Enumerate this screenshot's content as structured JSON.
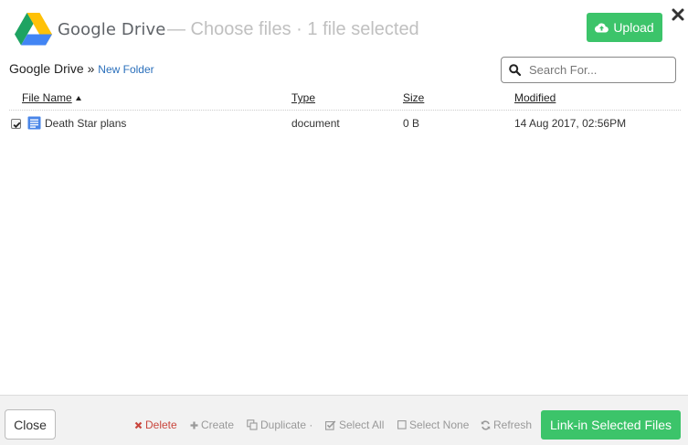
{
  "header": {
    "brand": "Google Drive",
    "subtitle": "— Choose files · 1 file selected",
    "upload_label": "Upload"
  },
  "breadcrumb": {
    "root": "Google Drive",
    "separator": "»",
    "current": "New Folder"
  },
  "search": {
    "placeholder": "Search For..."
  },
  "table": {
    "columns": [
      "File Name",
      "Type",
      "Size",
      "Modified"
    ],
    "sort": {
      "column": "File Name",
      "direction": "ascending"
    },
    "rows": [
      {
        "selected": true,
        "icon": "document-icon",
        "name": "Death Star plans",
        "type": "document",
        "size": "0 B",
        "modified": "14 Aug 2017, 02:56PM"
      }
    ]
  },
  "footer": {
    "close_label": "Close",
    "actions": {
      "delete": "Delete",
      "create": "Create",
      "duplicate": "Duplicate ·",
      "select_all": "Select All",
      "select_none": "Select None",
      "refresh": "Refresh"
    },
    "primary_label": "Link-in Selected Files"
  },
  "colors": {
    "accent_green": "#3cc46a",
    "link_blue": "#2a6fbb",
    "danger_red": "#c9463d",
    "muted_text": "#999999"
  }
}
